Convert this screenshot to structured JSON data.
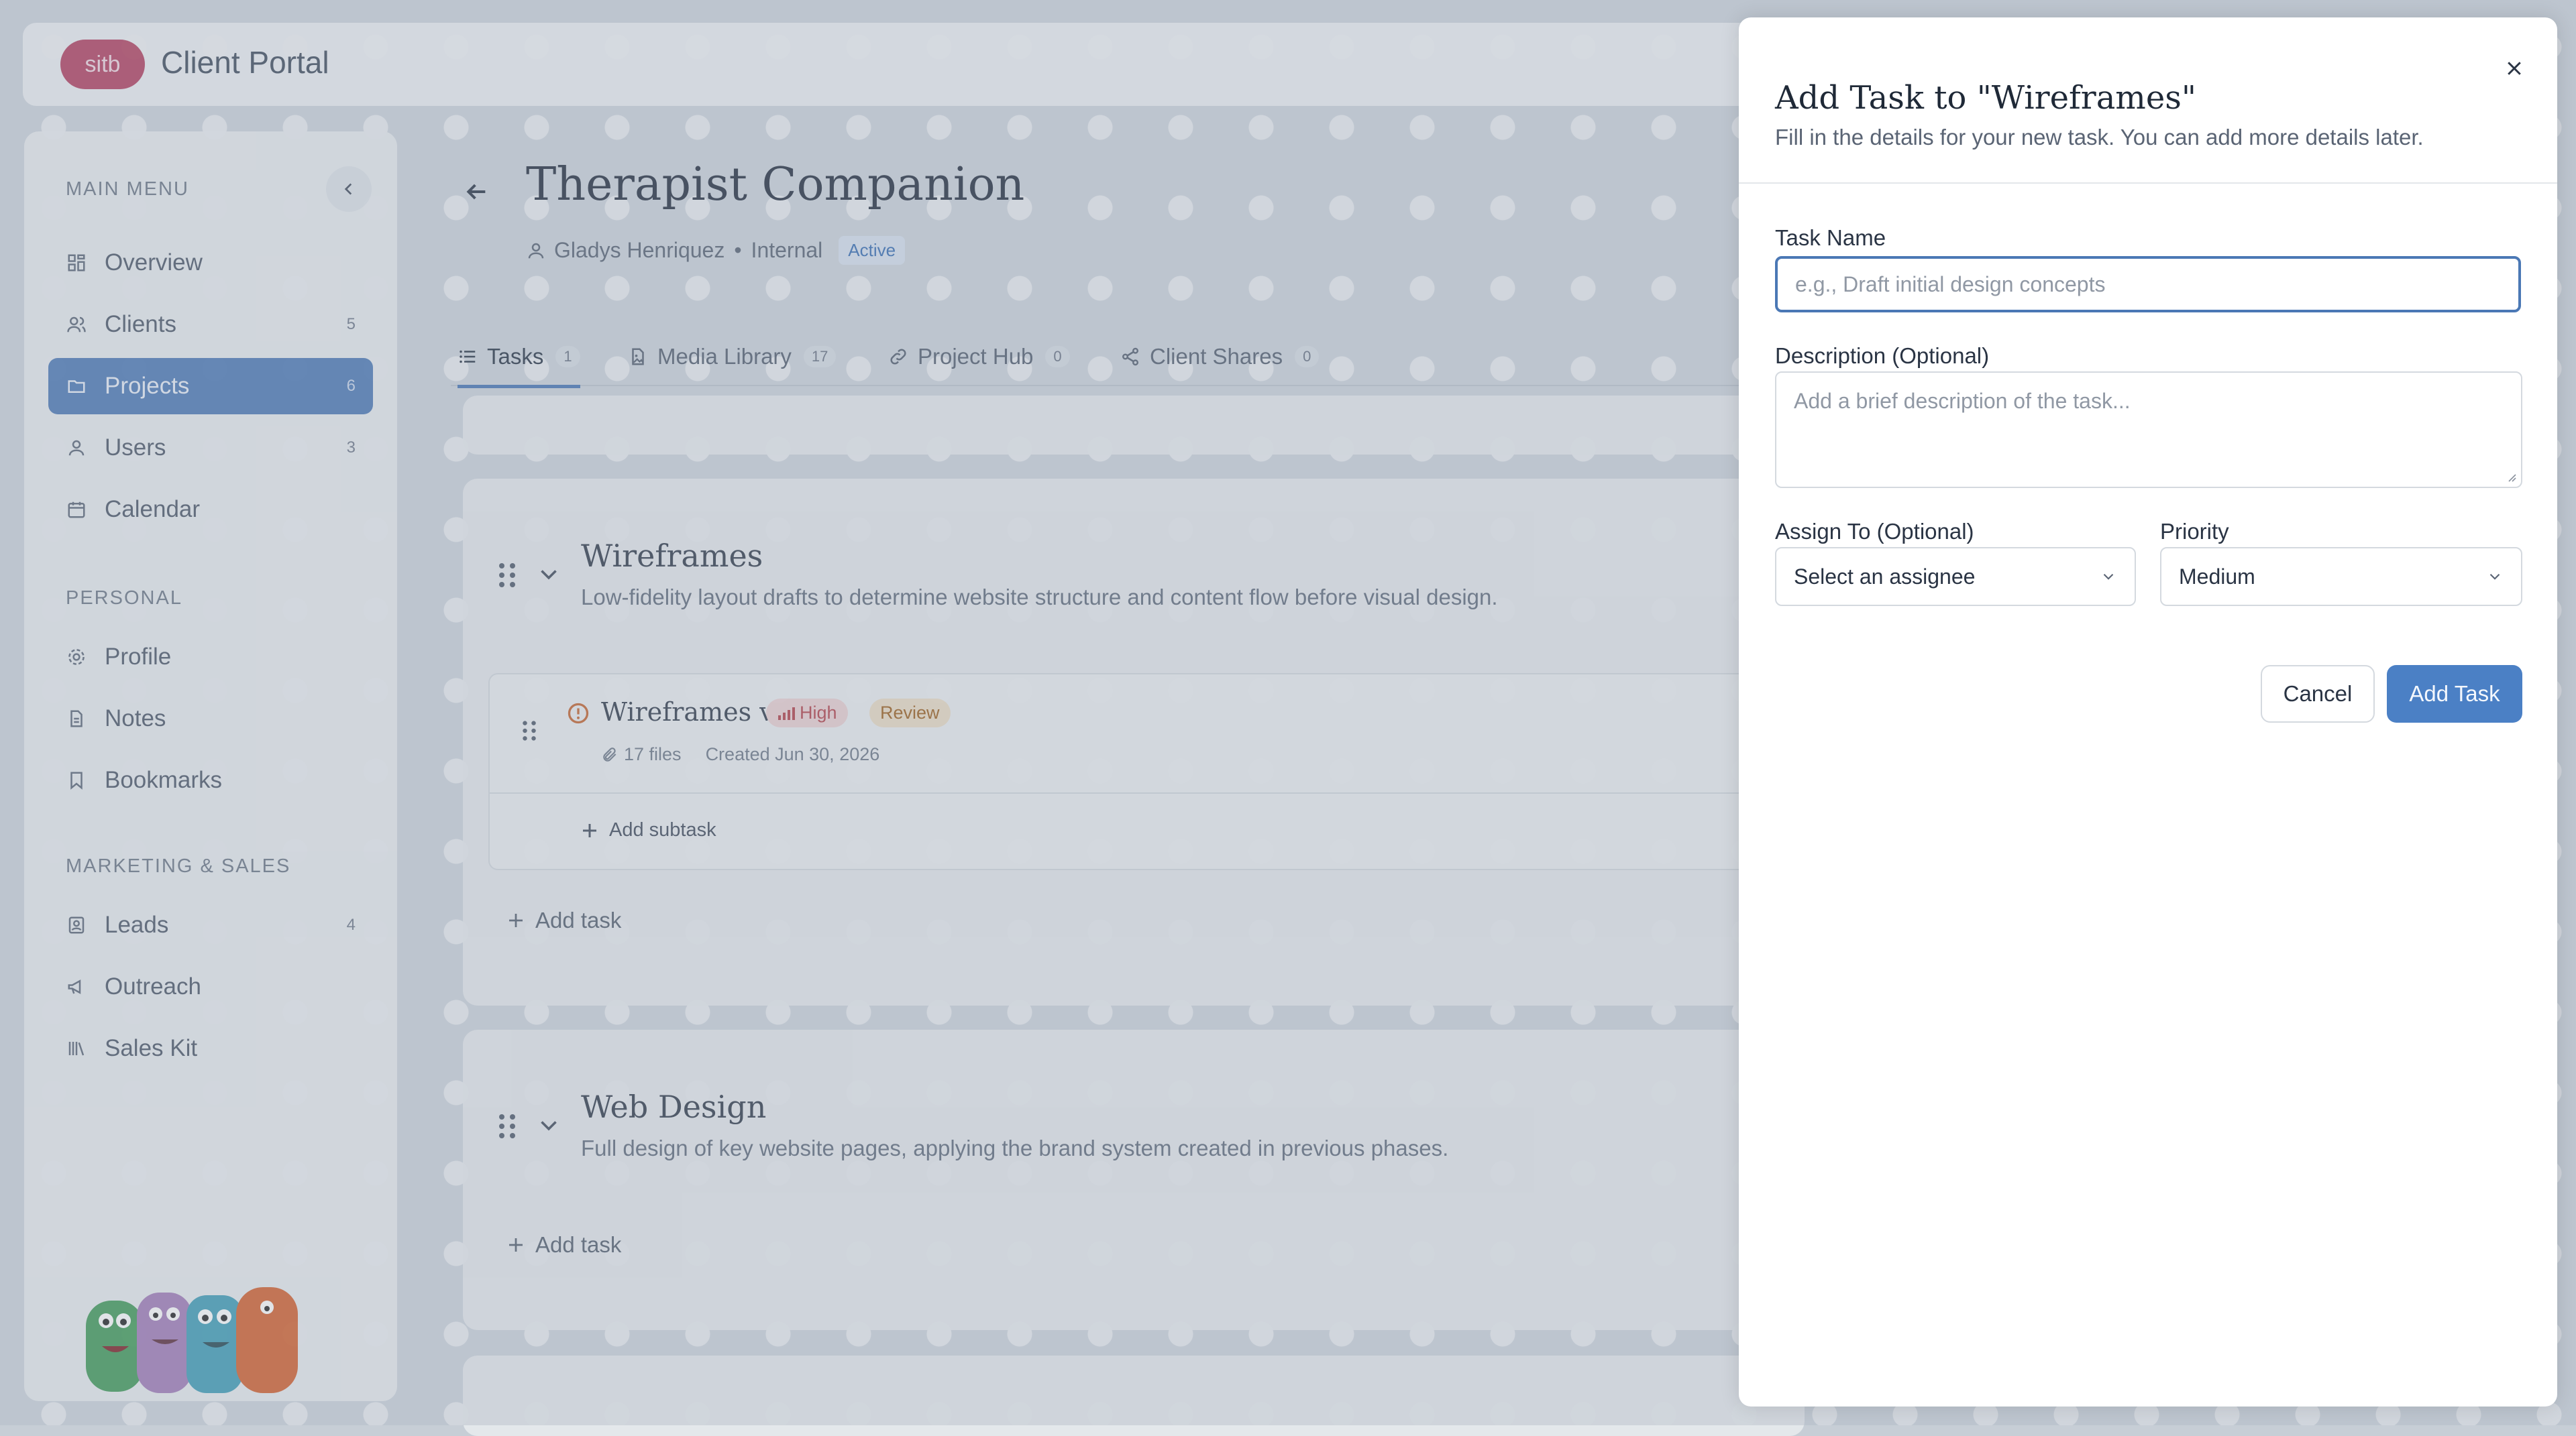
{
  "app": {
    "logo_text": "sitb",
    "title": "Client Portal"
  },
  "sidebar": {
    "main_heading": "MAIN MENU",
    "main_items": [
      {
        "label": "Overview",
        "count": "",
        "icon": "dashboard-icon"
      },
      {
        "label": "Clients",
        "count": "5",
        "icon": "users-icon"
      },
      {
        "label": "Projects",
        "count": "6",
        "icon": "folder-icon",
        "active": true
      },
      {
        "label": "Users",
        "count": "3",
        "icon": "user-icon"
      },
      {
        "label": "Calendar",
        "count": "",
        "icon": "calendar-icon"
      }
    ],
    "personal_heading": "PERSONAL",
    "personal_items": [
      {
        "label": "Profile",
        "icon": "gear-icon"
      },
      {
        "label": "Notes",
        "icon": "document-icon"
      },
      {
        "label": "Bookmarks",
        "icon": "bookmark-icon"
      }
    ],
    "marketing_heading": "MARKETING & SALES",
    "marketing_items": [
      {
        "label": "Leads",
        "count": "4",
        "icon": "contact-icon"
      },
      {
        "label": "Outreach",
        "count": "",
        "icon": "megaphone-icon"
      },
      {
        "label": "Sales Kit",
        "count": "",
        "icon": "library-icon"
      }
    ]
  },
  "project": {
    "title": "Therapist Companion",
    "owner": "Gladys Henriquez",
    "type": "Internal",
    "status": "Active"
  },
  "tabs": [
    {
      "label": "Tasks",
      "count": "1"
    },
    {
      "label": "Media Library",
      "count": "17"
    },
    {
      "label": "Project Hub",
      "count": "0"
    },
    {
      "label": "Client Shares",
      "count": "0"
    }
  ],
  "sections": [
    {
      "title": "Wireframes",
      "description": "Low-fidelity layout drafts to determine website structure and content flow before visual design.",
      "task": {
        "name": "Wireframes v1",
        "priority": "High",
        "status": "Review",
        "files": "17 files",
        "created": "Created Jun 30, 2026",
        "add_subtask": "Add subtask"
      },
      "add_task": "Add task"
    },
    {
      "title": "Web Design",
      "description": "Full design of key website pages, applying the brand system created in previous phases.",
      "add_task": "Add task"
    }
  ],
  "modal": {
    "title": "Add Task to \"Wireframes\"",
    "subtitle": "Fill in the details for your new task. You can add more details later.",
    "task_name_label": "Task Name",
    "task_name_placeholder": "e.g., Draft initial design concepts",
    "description_label": "Description (Optional)",
    "description_placeholder": "Add a brief description of the task...",
    "assign_label": "Assign To (Optional)",
    "assign_value": "Select an assignee",
    "priority_label": "Priority",
    "priority_value": "Medium",
    "cancel_label": "Cancel",
    "submit_label": "Add Task"
  },
  "colors": {
    "accent": "#4b78b5",
    "logo": "#b13a5a",
    "priority_high": "#b23c44",
    "status_review": "#9a5a16"
  }
}
